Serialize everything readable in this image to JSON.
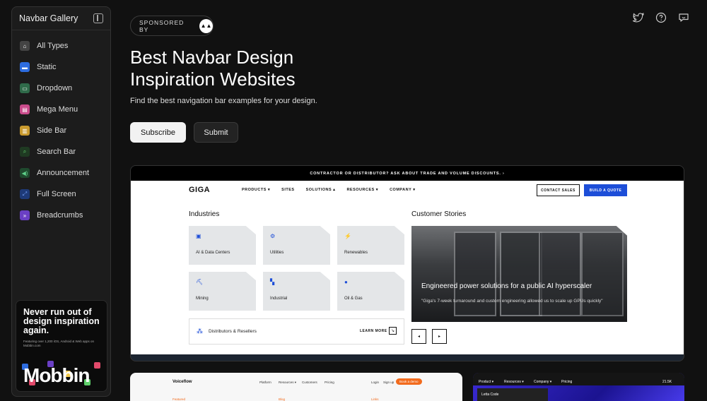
{
  "sidebar": {
    "title": "Navbar Gallery",
    "items": [
      {
        "label": "All Types",
        "icon": "home-icon",
        "color": "#444444"
      },
      {
        "label": "Static",
        "icon": "static-icon",
        "color": "#2d6cdf"
      },
      {
        "label": "Dropdown",
        "icon": "dropdown-icon",
        "color": "#2f6b4a"
      },
      {
        "label": "Mega Menu",
        "icon": "mega-menu-icon",
        "color": "#c94b8b"
      },
      {
        "label": "Side Bar",
        "icon": "sidebar-icon",
        "color": "#c99a2e"
      },
      {
        "label": "Search Bar",
        "icon": "search-icon",
        "color": "#3aa04a"
      },
      {
        "label": "Announcement",
        "icon": "megaphone-icon",
        "color": "#2f9e54"
      },
      {
        "label": "Full Screen",
        "icon": "expand-icon",
        "color": "#2d63c8"
      },
      {
        "label": "Breadcrumbs",
        "icon": "chevrons-icon",
        "color": "#6a3fc4"
      }
    ],
    "promo": {
      "headline": "Never run out of design inspiration again.",
      "sub": "Featuring over 1,200 iOS, Android & Web apps on Mobbin.com",
      "brand": "Mobbin"
    }
  },
  "hero": {
    "sponsor_label": "SPONSORED BY",
    "title": "Best Navbar Design Inspiration Websites",
    "subtitle": "Find the best navigation bar examples for your design.",
    "subscribe_label": "Subscribe",
    "submit_label": "Submit"
  },
  "preview": {
    "banner": "CONTRACTOR OR DISTRIBUTOR? ASK ABOUT TRADE AND VOLUME DISCOUNTS.  ›",
    "logo": "GIGA",
    "menu": [
      "PRODUCTS ▾",
      "SITES",
      "SOLUTIONS ▴",
      "RESOURCES ▾",
      "COMPANY ▾"
    ],
    "contact": "CONTACT SALES",
    "quote": "BUILD A QUOTE",
    "industries_title": "Industries",
    "industries": [
      {
        "label": "AI & Data Centers",
        "icon": "▣"
      },
      {
        "label": "Utilities",
        "icon": "⚙"
      },
      {
        "label": "Renewables",
        "icon": "⚡"
      },
      {
        "label": "Mining",
        "icon": "⛏"
      },
      {
        "label": "Industrial",
        "icon": "▚"
      },
      {
        "label": "Oil & Gas",
        "icon": "●"
      }
    ],
    "distributors": "Distributors & Resellers",
    "learn_more": "LEARN MORE",
    "customer_title": "Customer Stories",
    "story_head": "Engineered power solutions for a public AI hyperscaler",
    "story_body": "\"Giga's 7-week turnaround and custom engineering allowed us to scale up GPUs quickly\""
  },
  "bottom": {
    "vf_logo": "Voiceflow",
    "vf_menu": [
      "Platform",
      "Resources ▾",
      "Customers",
      "Pricing"
    ],
    "vf_login": "Login",
    "vf_signup": "Sign up",
    "vf_book": "Book a demo",
    "vf_cols": [
      "Featured",
      "Blog",
      "Links"
    ],
    "dark_menu": [
      "Product ▾",
      "Resources ▾",
      "Company ▾",
      "Pricing"
    ],
    "dark_item": "Letta Code",
    "dark_star": "21.5K"
  }
}
